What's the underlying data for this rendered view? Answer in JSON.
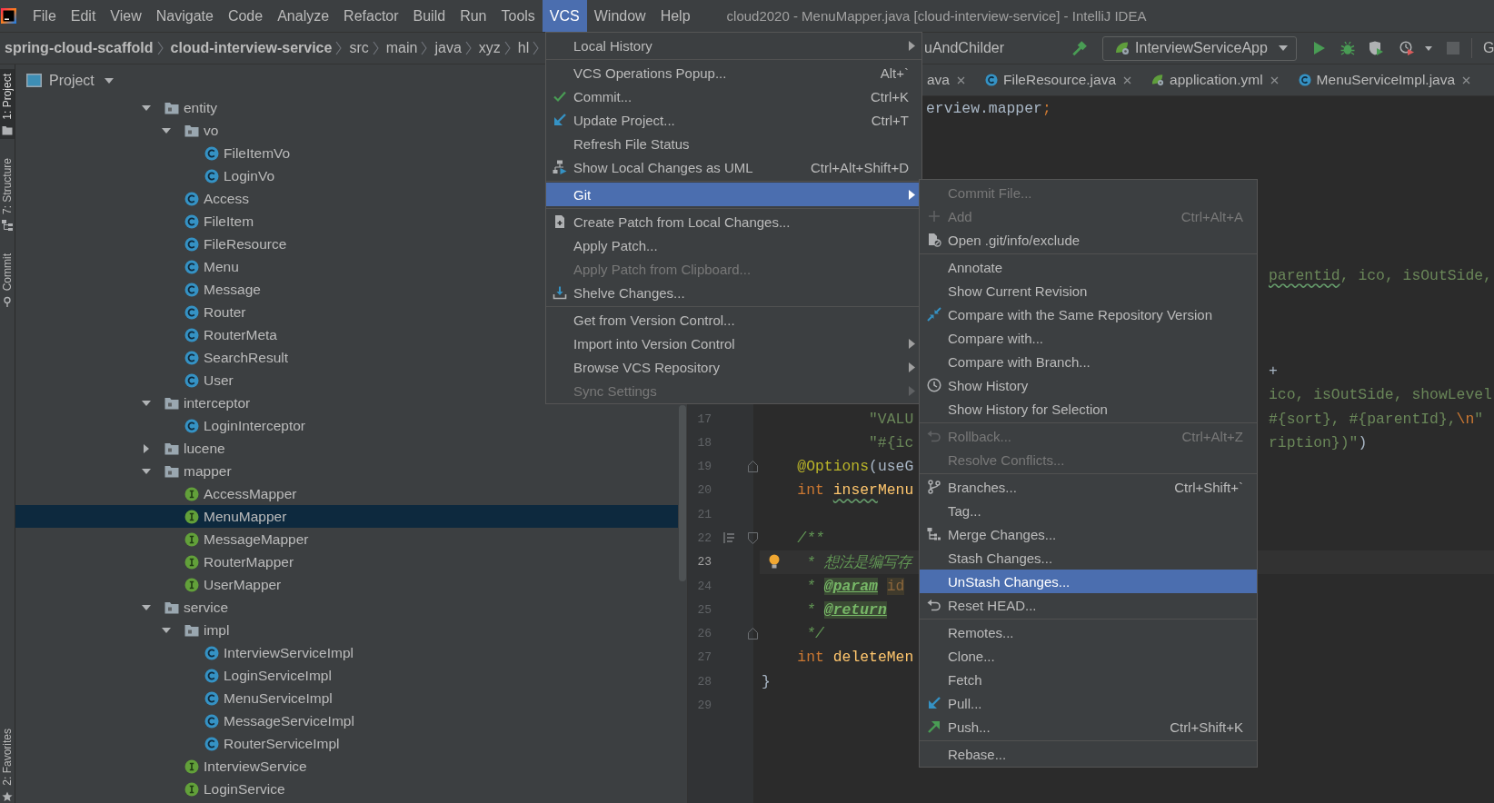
{
  "menubar": {
    "items": [
      {
        "label": "File",
        "selected": false
      },
      {
        "label": "Edit",
        "selected": false
      },
      {
        "label": "View",
        "selected": false
      },
      {
        "label": "Navigate",
        "selected": false
      },
      {
        "label": "Code",
        "selected": false
      },
      {
        "label": "Analyze",
        "selected": false
      },
      {
        "label": "Refactor",
        "selected": false
      },
      {
        "label": "Build",
        "selected": false
      },
      {
        "label": "Run",
        "selected": false
      },
      {
        "label": "Tools",
        "selected": false
      },
      {
        "label": "VCS",
        "selected": true
      },
      {
        "label": "Window",
        "selected": false
      },
      {
        "label": "Help",
        "selected": false
      }
    ],
    "title": "cloud2020 - MenuMapper.java [cloud-interview-service] - IntelliJ IDEA"
  },
  "navigation_bar": {
    "breadcrumbs": [
      {
        "label": "spring-cloud-scaffold",
        "kind": "module"
      },
      {
        "label": "cloud-interview-service",
        "kind": "module"
      },
      {
        "label": "src",
        "kind": "folder"
      },
      {
        "label": "main",
        "kind": "folder"
      },
      {
        "label": "java",
        "kind": "folder"
      },
      {
        "label": "xyz",
        "kind": "folder"
      },
      {
        "label": "hl",
        "kind": "folder"
      }
    ],
    "method_crumb": "uAndChilder",
    "run_configuration": "InterviewServiceApp",
    "vcs_widget": "G"
  },
  "tool_windows": {
    "top": [
      {
        "label": "1: Project",
        "selected": true
      },
      {
        "label": "7: Structure",
        "selected": false
      },
      {
        "label": "Commit",
        "selected": false
      }
    ],
    "bottom": [
      {
        "label": "2: Favorites",
        "selected": false
      }
    ]
  },
  "project": {
    "title": "Project",
    "tree": [
      {
        "name": "entity",
        "kind": "folder",
        "expanded": true,
        "selected": false,
        "children": [
          {
            "name": "vo",
            "kind": "folder",
            "expanded": true,
            "selected": false,
            "children": [
              {
                "name": "FileItemVo",
                "kind": "class",
                "selected": false
              },
              {
                "name": "LoginVo",
                "kind": "class",
                "selected": false
              }
            ]
          },
          {
            "name": "Access",
            "kind": "class",
            "selected": false
          },
          {
            "name": "FileItem",
            "kind": "class",
            "selected": false
          },
          {
            "name": "FileResource",
            "kind": "class",
            "selected": false
          },
          {
            "name": "Menu",
            "kind": "class",
            "selected": false
          },
          {
            "name": "Message",
            "kind": "class",
            "selected": false
          },
          {
            "name": "Router",
            "kind": "class",
            "selected": false
          },
          {
            "name": "RouterMeta",
            "kind": "class",
            "selected": false
          },
          {
            "name": "SearchResult",
            "kind": "class",
            "selected": false
          },
          {
            "name": "User",
            "kind": "class",
            "selected": false
          }
        ]
      },
      {
        "name": "interceptor",
        "kind": "folder",
        "expanded": true,
        "selected": false,
        "children": [
          {
            "name": "LoginInterceptor",
            "kind": "class",
            "selected": false
          }
        ]
      },
      {
        "name": "lucene",
        "kind": "folder",
        "expanded": false,
        "selected": false
      },
      {
        "name": "mapper",
        "kind": "folder",
        "expanded": true,
        "selected": false,
        "children": [
          {
            "name": "AccessMapper",
            "kind": "interface",
            "selected": false
          },
          {
            "name": "MenuMapper",
            "kind": "interface",
            "selected": true
          },
          {
            "name": "MessageMapper",
            "kind": "interface",
            "selected": false
          },
          {
            "name": "RouterMapper",
            "kind": "interface",
            "selected": false
          },
          {
            "name": "UserMapper",
            "kind": "interface",
            "selected": false
          }
        ]
      },
      {
        "name": "service",
        "kind": "folder",
        "expanded": true,
        "selected": false,
        "children": [
          {
            "name": "impl",
            "kind": "folder",
            "expanded": true,
            "selected": false,
            "children": [
              {
                "name": "InterviewServiceImpl",
                "kind": "class",
                "selected": false
              },
              {
                "name": "LoginServiceImpl",
                "kind": "class",
                "selected": false
              },
              {
                "name": "MenuServiceImpl",
                "kind": "class",
                "selected": false
              },
              {
                "name": "MessageServiceImpl",
                "kind": "class",
                "selected": false
              },
              {
                "name": "RouterServiceImpl",
                "kind": "class",
                "selected": false
              }
            ]
          },
          {
            "name": "InterviewService",
            "kind": "interface",
            "selected": false
          },
          {
            "name": "LoginService",
            "kind": "interface",
            "selected": false
          }
        ]
      }
    ]
  },
  "editor": {
    "tabs": [
      {
        "label": "ava",
        "selected": false
      },
      {
        "label": "FileResource.java",
        "kind": "java",
        "selected": false
      },
      {
        "label": "application.yml",
        "kind": "yml",
        "selected": false
      },
      {
        "label": "MenuServiceImpl.java",
        "kind": "java",
        "selected": false
      }
    ],
    "fragments": [
      {
        "lines": [
          {
            "segments": [
              {
                "text": "erview.mapper",
                "kind": "plain",
                "typo": false
              },
              {
                "text": ";",
                "kind": "keyword",
                "typo": false
              }
            ]
          }
        ]
      },
      {
        "lines": [
          {
            "segments": [
              {
                "text": "parentid",
                "kind": "string",
                "typo": true
              },
              {
                "text": ", ico, isOutSide,",
                "kind": "string",
                "typo": false
              }
            ]
          }
        ]
      },
      {
        "lines": [
          {
            "segments": [
              {
                "text": "+",
                "kind": "plain",
                "typo": false
              }
            ]
          },
          {
            "segments": [
              {
                "text": "ico, isOutSide, showLevel",
                "kind": "string",
                "typo": false
              }
            ]
          },
          {
            "segments": [
              {
                "text": "#{sort}, #{parentId},",
                "kind": "string",
                "typo": false
              },
              {
                "text": "\\n",
                "kind": "escape",
                "typo": false
              },
              {
                "text": "\"",
                "kind": "string",
                "typo": false
              }
            ]
          },
          {
            "segments": [
              {
                "text": "ription})\"",
                "kind": "string",
                "typo": false
              },
              {
                "text": ")",
                "kind": "plain",
                "typo": false
              }
            ]
          }
        ]
      }
    ],
    "lines": [
      {
        "number": "17",
        "current": false,
        "segments": [
          {
            "text": "            \"VALU",
            "kind": "string",
            "typo": false
          }
        ]
      },
      {
        "number": "18",
        "current": false,
        "segments": [
          {
            "text": "            \"#{ic",
            "kind": "string",
            "typo": false
          }
        ]
      },
      {
        "number": "19",
        "current": false,
        "fold_end": true,
        "segments": [
          {
            "text": "    @Options",
            "kind": "annotation",
            "typo": false
          },
          {
            "text": "(useG",
            "kind": "plain",
            "typo": false
          }
        ]
      },
      {
        "number": "20",
        "current": false,
        "segments": [
          {
            "text": "    int ",
            "kind": "keyword",
            "typo": false
          },
          {
            "text": "inser",
            "kind": "method",
            "typo": true
          },
          {
            "text": "Menu",
            "kind": "method",
            "typo": false
          }
        ]
      },
      {
        "number": "21",
        "current": false
      },
      {
        "number": "22",
        "current": false,
        "fold_start": true,
        "doc_toggle": true,
        "segments": [
          {
            "text": "    /**",
            "kind": "doc",
            "typo": false
          }
        ]
      },
      {
        "number": "23",
        "current": true,
        "bulb": true,
        "segments": [
          {
            "text": "     * 想法是编写存",
            "kind": "doc",
            "typo": false
          }
        ]
      },
      {
        "number": "24",
        "current": false,
        "segments": [
          {
            "text": "     * ",
            "kind": "doc",
            "typo": false
          },
          {
            "text": "@param",
            "kind": "doc-tag",
            "typo": false
          },
          {
            "text": " id",
            "kind": "doc-param",
            "typo": false
          }
        ]
      },
      {
        "number": "25",
        "current": false,
        "segments": [
          {
            "text": "     * ",
            "kind": "doc",
            "typo": false
          },
          {
            "text": "@return",
            "kind": "doc-tag",
            "typo": false
          }
        ]
      },
      {
        "number": "26",
        "current": false,
        "fold_end": true,
        "segments": [
          {
            "text": "     */",
            "kind": "doc",
            "typo": false
          }
        ]
      },
      {
        "number": "27",
        "current": false,
        "segments": [
          {
            "text": "    int ",
            "kind": "keyword",
            "typo": false
          },
          {
            "text": "deleteMen",
            "kind": "method",
            "typo": false
          }
        ]
      },
      {
        "number": "28",
        "current": false,
        "segments": [
          {
            "text": "}",
            "kind": "plain",
            "typo": false
          }
        ]
      },
      {
        "number": "29",
        "current": false
      }
    ]
  },
  "vcs_menu": {
    "groups": [
      {
        "items": [
          {
            "label": "Local History",
            "submenu": true,
            "disabled": false,
            "selected": false
          }
        ]
      },
      {
        "items": [
          {
            "label": "VCS Operations Popup...",
            "shortcut": "Alt+`",
            "submenu": false,
            "disabled": false,
            "selected": false
          },
          {
            "label": "Commit...",
            "shortcut": "Ctrl+K",
            "submenu": false,
            "disabled": false,
            "selected": false
          },
          {
            "label": "Update Project...",
            "shortcut": "Ctrl+T",
            "submenu": false,
            "disabled": false,
            "selected": false
          },
          {
            "label": "Refresh File Status",
            "submenu": false,
            "disabled": false,
            "selected": false
          },
          {
            "label": "Show Local Changes as UML",
            "shortcut": "Ctrl+Alt+Shift+D",
            "submenu": false,
            "disabled": false,
            "selected": false
          }
        ]
      },
      {
        "items": [
          {
            "label": "Git",
            "submenu": true,
            "disabled": false,
            "selected": true
          }
        ]
      },
      {
        "items": [
          {
            "label": "Create Patch from Local Changes...",
            "submenu": false,
            "disabled": false,
            "selected": false
          },
          {
            "label": "Apply Patch...",
            "submenu": false,
            "disabled": false,
            "selected": false
          },
          {
            "label": "Apply Patch from Clipboard...",
            "submenu": false,
            "disabled": true,
            "selected": false
          },
          {
            "label": "Shelve Changes...",
            "submenu": false,
            "disabled": false,
            "selected": false
          }
        ]
      },
      {
        "items": [
          {
            "label": "Get from Version Control...",
            "submenu": false,
            "disabled": false,
            "selected": false
          },
          {
            "label": "Import into Version Control",
            "submenu": true,
            "disabled": false,
            "selected": false
          },
          {
            "label": "Browse VCS Repository",
            "submenu": true,
            "disabled": false,
            "selected": false
          },
          {
            "label": "Sync Settings",
            "submenu": true,
            "disabled": true,
            "selected": false
          }
        ]
      }
    ]
  },
  "git_submenu": {
    "groups": [
      {
        "items": [
          {
            "label": "Commit File...",
            "submenu": false,
            "disabled": true,
            "selected": false
          },
          {
            "label": "Add",
            "shortcut": "Ctrl+Alt+A",
            "submenu": false,
            "disabled": true,
            "selected": false
          },
          {
            "label": "Open .git/info/exclude",
            "submenu": false,
            "disabled": false,
            "selected": false
          }
        ]
      },
      {
        "items": [
          {
            "label": "Annotate",
            "submenu": false,
            "disabled": false,
            "selected": false
          },
          {
            "label": "Show Current Revision",
            "submenu": false,
            "disabled": false,
            "selected": false
          },
          {
            "label": "Compare with the Same Repository Version",
            "submenu": false,
            "disabled": false,
            "selected": false
          },
          {
            "label": "Compare with...",
            "submenu": false,
            "disabled": false,
            "selected": false
          },
          {
            "label": "Compare with Branch...",
            "submenu": false,
            "disabled": false,
            "selected": false
          },
          {
            "label": "Show History",
            "submenu": false,
            "disabled": false,
            "selected": false
          },
          {
            "label": "Show History for Selection",
            "submenu": false,
            "disabled": false,
            "selected": false
          }
        ]
      },
      {
        "items": [
          {
            "label": "Rollback...",
            "shortcut": "Ctrl+Alt+Z",
            "submenu": false,
            "disabled": true,
            "selected": false
          },
          {
            "label": "Resolve Conflicts...",
            "submenu": false,
            "disabled": true,
            "selected": false
          }
        ]
      },
      {
        "items": [
          {
            "label": "Branches...",
            "shortcut": "Ctrl+Shift+`",
            "submenu": false,
            "disabled": false,
            "selected": false
          },
          {
            "label": "Tag...",
            "submenu": false,
            "disabled": false,
            "selected": false
          },
          {
            "label": "Merge Changes...",
            "submenu": false,
            "disabled": false,
            "selected": false
          },
          {
            "label": "Stash Changes...",
            "submenu": false,
            "disabled": false,
            "selected": false
          },
          {
            "label": "UnStash Changes...",
            "submenu": false,
            "disabled": false,
            "selected": true
          },
          {
            "label": "Reset HEAD...",
            "submenu": false,
            "disabled": false,
            "selected": false
          }
        ]
      },
      {
        "items": [
          {
            "label": "Remotes...",
            "submenu": false,
            "disabled": false,
            "selected": false
          },
          {
            "label": "Clone...",
            "submenu": false,
            "disabled": false,
            "selected": false
          },
          {
            "label": "Fetch",
            "submenu": false,
            "disabled": false,
            "selected": false
          },
          {
            "label": "Pull...",
            "submenu": false,
            "disabled": false,
            "selected": false
          },
          {
            "label": "Push...",
            "shortcut": "Ctrl+Shift+K",
            "submenu": false,
            "disabled": false,
            "selected": false
          }
        ]
      },
      {
        "items": [
          {
            "label": "Rebase...",
            "submenu": false,
            "disabled": false,
            "selected": false
          }
        ]
      }
    ]
  }
}
